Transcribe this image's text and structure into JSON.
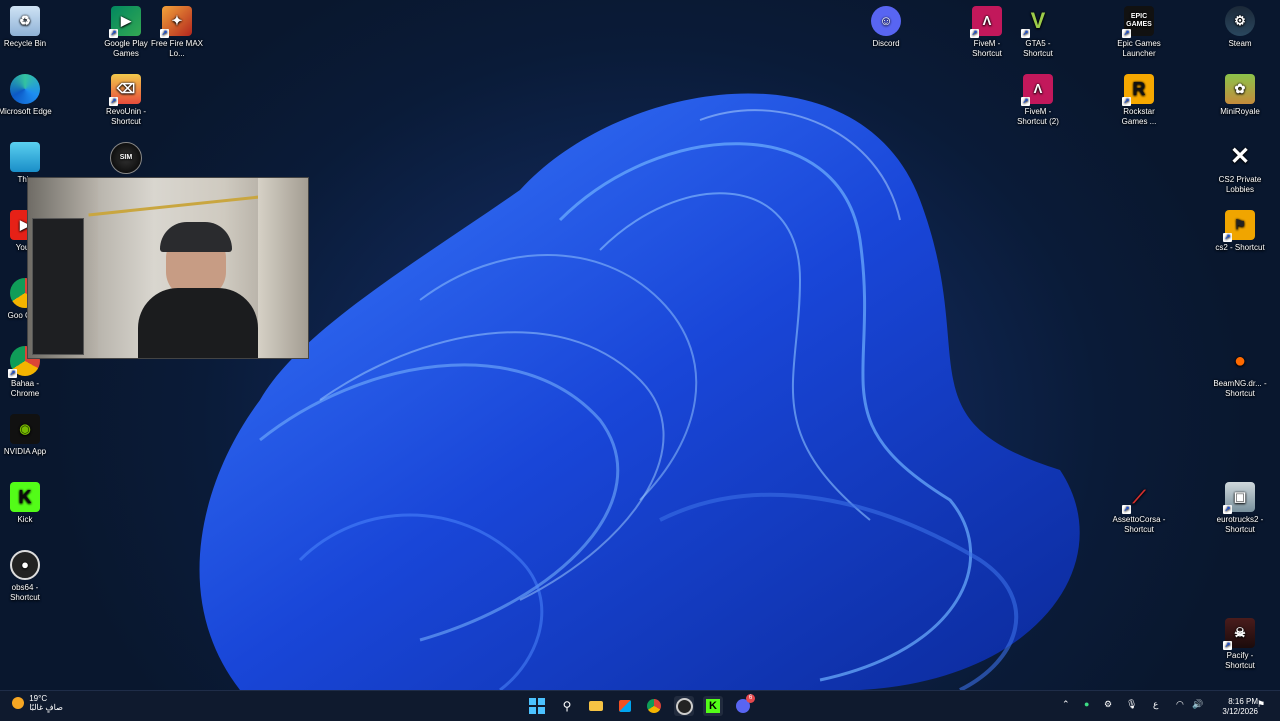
{
  "desktop": {
    "icons": {
      "recycle_bin": "Recycle Bin",
      "google_play_games": "Google Play Games",
      "free_fire": "Free Fire MAX Lo...",
      "discord": "Discord",
      "fivem": "FiveM - Shortcut",
      "gta5": "GTA5 - Shortcut",
      "epic": "Epic Games Launcher",
      "steam": "Steam",
      "edge": "Microsoft Edge",
      "revo": "RevoUnin - Shortcut",
      "fivem2": "FiveM - Shortcut (2)",
      "rockstar": "Rockstar Games ...",
      "miniroyale": "MiniRoyale",
      "this_pc": "This",
      "cs2_private": "CS2 Private Lobbies",
      "youtube": "YouT",
      "cs2": "cs2 - Shortcut",
      "google_chrome": "Goo Chro",
      "bahaa_chrome": "Bahaa - Chrome",
      "beamng": "BeamNG.dr... - Shortcut",
      "nvidia": "NVIDIA App",
      "kick": "Kick",
      "assetto": "AssettoCorsa - Shortcut",
      "eurotrucks": "eurotrucks2 - Shortcut",
      "obs": "obs64 - Shortcut",
      "pacify": "Pacify - Shortcut"
    },
    "icon_glyphs": {
      "epic_text": "EPIC GAMES",
      "rockstar_letter": "R",
      "kick_letter": "K",
      "sim_text": "SIM"
    }
  },
  "taskbar": {
    "weather_temp": "19°C",
    "weather_desc": "صافٍ غالبًا",
    "clock_time": "8:16 PM",
    "clock_date": "3/12/2026",
    "lang": "ع",
    "discord_badge": "6"
  },
  "colors": {
    "accent": "#1a4fd6",
    "taskbar_bg": "#0f1a2e"
  }
}
